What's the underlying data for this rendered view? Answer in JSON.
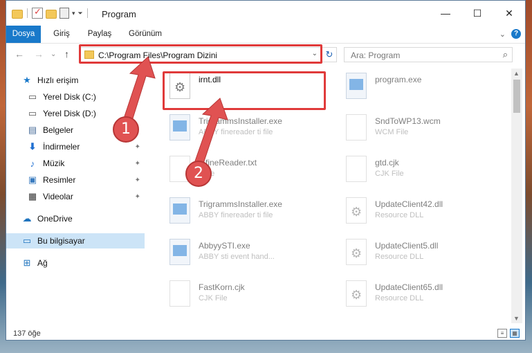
{
  "window": {
    "title": "Program"
  },
  "ribbon": {
    "tabs": [
      "Dosya",
      "Giriş",
      "Paylaş",
      "Görünüm"
    ]
  },
  "address": {
    "path": "C:\\Program Files\\Program Dizini",
    "search_placeholder": "Ara: Program"
  },
  "sidebar": {
    "items": [
      {
        "label": "Hızlı erişim",
        "icon": "star-icon"
      },
      {
        "label": "Yerel Disk (C:)",
        "icon": "drive-icon"
      },
      {
        "label": "Yerel Disk (D:)",
        "icon": "drive-icon"
      },
      {
        "label": "Belgeler",
        "icon": "document-icon"
      },
      {
        "label": "İndirmeler",
        "icon": "download-icon"
      },
      {
        "label": "Müzik",
        "icon": "music-icon"
      },
      {
        "label": "Resimler",
        "icon": "picture-icon"
      },
      {
        "label": "Videolar",
        "icon": "video-icon"
      },
      {
        "label": "OneDrive",
        "icon": "cloud-icon"
      },
      {
        "label": "Bu bilgisayar",
        "icon": "computer-icon"
      },
      {
        "label": "Ağ",
        "icon": "network-icon"
      }
    ]
  },
  "files": [
    {
      "name": "irnt.dll",
      "desc": "",
      "icon": "dll-icon"
    },
    {
      "name": "program.exe",
      "desc": "",
      "icon": "app-icon"
    },
    {
      "name": "TrigrammsInstaller.exe",
      "desc": "ABBY finereader ti file",
      "icon": "app-icon"
    },
    {
      "name": "SndToWP13.wcm",
      "desc": "WCM File",
      "icon": "file-icon"
    },
    {
      "name": "...fineReader.txt",
      "desc": "...file",
      "icon": "file-icon"
    },
    {
      "name": "gtd.cjk",
      "desc": "CJK File",
      "icon": "file-icon"
    },
    {
      "name": "TrigrammsInstaller.exe",
      "desc": "ABBY finereader ti file",
      "icon": "app-icon"
    },
    {
      "name": "UpdateClient42.dll",
      "desc": "Resource DLL",
      "icon": "dll-icon"
    },
    {
      "name": "AbbyySTI.exe",
      "desc": "ABBY sti event hand...",
      "icon": "app-icon"
    },
    {
      "name": "UpdateClient5.dll",
      "desc": "Resource DLL",
      "icon": "dll-icon"
    },
    {
      "name": "FastKorn.cjk",
      "desc": "CJK File",
      "icon": "file-icon"
    },
    {
      "name": "UpdateClient65.dll",
      "desc": "Resource DLL",
      "icon": "dll-icon"
    }
  ],
  "status": {
    "count": "137 öğe"
  },
  "annotations": {
    "step1": "1",
    "step2": "2"
  },
  "colors": {
    "accent": "#1979ca",
    "highlight": "#e03a3a",
    "badge": "#e05252"
  }
}
